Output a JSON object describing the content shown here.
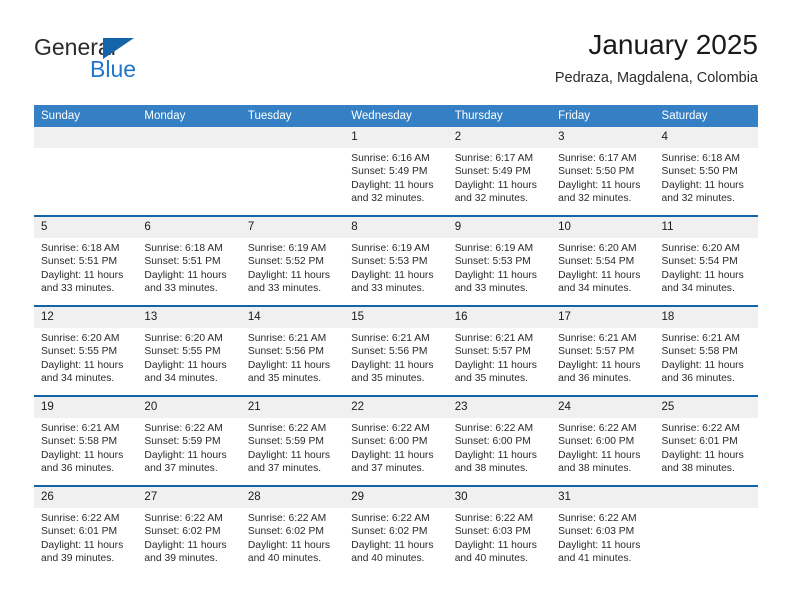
{
  "brand": {
    "name_part1": "General",
    "name_part2": "Blue",
    "accent_color": "#1464aa",
    "secondary_color": "#2277c8"
  },
  "header": {
    "title": "January 2025",
    "subtitle": "Pedraza, Magdalena, Colombia"
  },
  "theme": {
    "header_row_bg": "#3580c4",
    "week_separator": "#1464aa",
    "daynum_bg": "#f0f0f0"
  },
  "weekdays": [
    "Sunday",
    "Monday",
    "Tuesday",
    "Wednesday",
    "Thursday",
    "Friday",
    "Saturday"
  ],
  "weeks": [
    [
      {
        "day": "",
        "lines": []
      },
      {
        "day": "",
        "lines": []
      },
      {
        "day": "",
        "lines": []
      },
      {
        "day": "1",
        "lines": [
          "Sunrise: 6:16 AM",
          "Sunset: 5:49 PM",
          "Daylight: 11 hours",
          "and 32 minutes."
        ]
      },
      {
        "day": "2",
        "lines": [
          "Sunrise: 6:17 AM",
          "Sunset: 5:49 PM",
          "Daylight: 11 hours",
          "and 32 minutes."
        ]
      },
      {
        "day": "3",
        "lines": [
          "Sunrise: 6:17 AM",
          "Sunset: 5:50 PM",
          "Daylight: 11 hours",
          "and 32 minutes."
        ]
      },
      {
        "day": "4",
        "lines": [
          "Sunrise: 6:18 AM",
          "Sunset: 5:50 PM",
          "Daylight: 11 hours",
          "and 32 minutes."
        ]
      }
    ],
    [
      {
        "day": "5",
        "lines": [
          "Sunrise: 6:18 AM",
          "Sunset: 5:51 PM",
          "Daylight: 11 hours",
          "and 33 minutes."
        ]
      },
      {
        "day": "6",
        "lines": [
          "Sunrise: 6:18 AM",
          "Sunset: 5:51 PM",
          "Daylight: 11 hours",
          "and 33 minutes."
        ]
      },
      {
        "day": "7",
        "lines": [
          "Sunrise: 6:19 AM",
          "Sunset: 5:52 PM",
          "Daylight: 11 hours",
          "and 33 minutes."
        ]
      },
      {
        "day": "8",
        "lines": [
          "Sunrise: 6:19 AM",
          "Sunset: 5:53 PM",
          "Daylight: 11 hours",
          "and 33 minutes."
        ]
      },
      {
        "day": "9",
        "lines": [
          "Sunrise: 6:19 AM",
          "Sunset: 5:53 PM",
          "Daylight: 11 hours",
          "and 33 minutes."
        ]
      },
      {
        "day": "10",
        "lines": [
          "Sunrise: 6:20 AM",
          "Sunset: 5:54 PM",
          "Daylight: 11 hours",
          "and 34 minutes."
        ]
      },
      {
        "day": "11",
        "lines": [
          "Sunrise: 6:20 AM",
          "Sunset: 5:54 PM",
          "Daylight: 11 hours",
          "and 34 minutes."
        ]
      }
    ],
    [
      {
        "day": "12",
        "lines": [
          "Sunrise: 6:20 AM",
          "Sunset: 5:55 PM",
          "Daylight: 11 hours",
          "and 34 minutes."
        ]
      },
      {
        "day": "13",
        "lines": [
          "Sunrise: 6:20 AM",
          "Sunset: 5:55 PM",
          "Daylight: 11 hours",
          "and 34 minutes."
        ]
      },
      {
        "day": "14",
        "lines": [
          "Sunrise: 6:21 AM",
          "Sunset: 5:56 PM",
          "Daylight: 11 hours",
          "and 35 minutes."
        ]
      },
      {
        "day": "15",
        "lines": [
          "Sunrise: 6:21 AM",
          "Sunset: 5:56 PM",
          "Daylight: 11 hours",
          "and 35 minutes."
        ]
      },
      {
        "day": "16",
        "lines": [
          "Sunrise: 6:21 AM",
          "Sunset: 5:57 PM",
          "Daylight: 11 hours",
          "and 35 minutes."
        ]
      },
      {
        "day": "17",
        "lines": [
          "Sunrise: 6:21 AM",
          "Sunset: 5:57 PM",
          "Daylight: 11 hours",
          "and 36 minutes."
        ]
      },
      {
        "day": "18",
        "lines": [
          "Sunrise: 6:21 AM",
          "Sunset: 5:58 PM",
          "Daylight: 11 hours",
          "and 36 minutes."
        ]
      }
    ],
    [
      {
        "day": "19",
        "lines": [
          "Sunrise: 6:21 AM",
          "Sunset: 5:58 PM",
          "Daylight: 11 hours",
          "and 36 minutes."
        ]
      },
      {
        "day": "20",
        "lines": [
          "Sunrise: 6:22 AM",
          "Sunset: 5:59 PM",
          "Daylight: 11 hours",
          "and 37 minutes."
        ]
      },
      {
        "day": "21",
        "lines": [
          "Sunrise: 6:22 AM",
          "Sunset: 5:59 PM",
          "Daylight: 11 hours",
          "and 37 minutes."
        ]
      },
      {
        "day": "22",
        "lines": [
          "Sunrise: 6:22 AM",
          "Sunset: 6:00 PM",
          "Daylight: 11 hours",
          "and 37 minutes."
        ]
      },
      {
        "day": "23",
        "lines": [
          "Sunrise: 6:22 AM",
          "Sunset: 6:00 PM",
          "Daylight: 11 hours",
          "and 38 minutes."
        ]
      },
      {
        "day": "24",
        "lines": [
          "Sunrise: 6:22 AM",
          "Sunset: 6:00 PM",
          "Daylight: 11 hours",
          "and 38 minutes."
        ]
      },
      {
        "day": "25",
        "lines": [
          "Sunrise: 6:22 AM",
          "Sunset: 6:01 PM",
          "Daylight: 11 hours",
          "and 38 minutes."
        ]
      }
    ],
    [
      {
        "day": "26",
        "lines": [
          "Sunrise: 6:22 AM",
          "Sunset: 6:01 PM",
          "Daylight: 11 hours",
          "and 39 minutes."
        ]
      },
      {
        "day": "27",
        "lines": [
          "Sunrise: 6:22 AM",
          "Sunset: 6:02 PM",
          "Daylight: 11 hours",
          "and 39 minutes."
        ]
      },
      {
        "day": "28",
        "lines": [
          "Sunrise: 6:22 AM",
          "Sunset: 6:02 PM",
          "Daylight: 11 hours",
          "and 40 minutes."
        ]
      },
      {
        "day": "29",
        "lines": [
          "Sunrise: 6:22 AM",
          "Sunset: 6:02 PM",
          "Daylight: 11 hours",
          "and 40 minutes."
        ]
      },
      {
        "day": "30",
        "lines": [
          "Sunrise: 6:22 AM",
          "Sunset: 6:03 PM",
          "Daylight: 11 hours",
          "and 40 minutes."
        ]
      },
      {
        "day": "31",
        "lines": [
          "Sunrise: 6:22 AM",
          "Sunset: 6:03 PM",
          "Daylight: 11 hours",
          "and 41 minutes."
        ]
      },
      {
        "day": "",
        "lines": []
      }
    ]
  ]
}
